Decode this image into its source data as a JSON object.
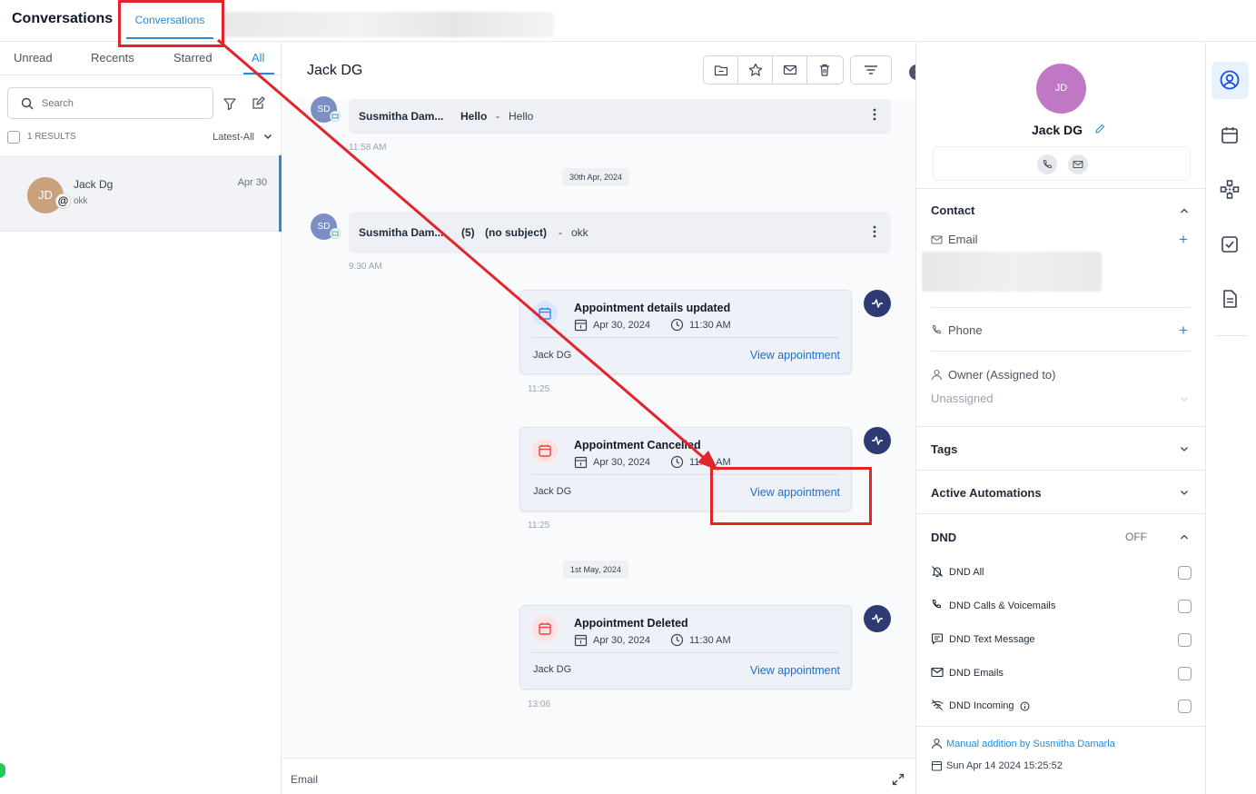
{
  "header": {
    "app_title": "Conversations",
    "active_tab": "Conversations"
  },
  "left_panel": {
    "tabs": [
      "Unread",
      "Recents",
      "Starred",
      "All"
    ],
    "search_placeholder": "Search",
    "results_label": "1 RESULTS",
    "sort_label": "Latest-All",
    "conversation": {
      "initials": "JD",
      "name": "Jack Dg",
      "preview": "okk",
      "date": "Apr 30",
      "badge": "@"
    }
  },
  "thread": {
    "title": "Jack DG",
    "messages": [
      {
        "initials": "SD",
        "sender": "Susmitha Dam...",
        "subject": "Hello",
        "separator": "-",
        "body": "Hello",
        "time": "11:58 AM"
      },
      {
        "initials": "SD",
        "sender": "Susmitha Dam...",
        "count": "(5)",
        "subject": "(no subject)",
        "separator": "-",
        "body": "okk",
        "time": "9:30 AM"
      }
    ],
    "date_dividers": [
      "30th Apr, 2024",
      "1st May, 2024"
    ],
    "appointments": [
      {
        "title": "Appointment details updated",
        "date": "Apr 30, 2024",
        "time": "11:30 AM",
        "owner": "Jack DG",
        "link": "View appointment",
        "timestamp": "11:25",
        "accent": "#3b82f6"
      },
      {
        "title": "Appointment Cancelled",
        "date": "Apr 30, 2024",
        "time": "11:30 AM",
        "owner": "Jack DG",
        "link": "View appointment",
        "timestamp": "11:25",
        "accent": "#ef4444"
      },
      {
        "title": "Appointment Deleted",
        "date": "Apr 30, 2024",
        "time": "11:30 AM",
        "owner": "Jack DG",
        "link": "View appointment",
        "timestamp": "13:06",
        "accent": "#ef4444"
      }
    ],
    "composer_label": "Email"
  },
  "contact": {
    "initials": "JD",
    "name": "Jack DG",
    "sections": {
      "contact": "Contact",
      "email_label": "Email",
      "phone_label": "Phone",
      "owner_label": "Owner (Assigned to)",
      "owner_value": "Unassigned",
      "tags": "Tags",
      "automations": "Active Automations",
      "dnd": "DND",
      "dnd_status": "OFF"
    },
    "dnd_options": [
      "DND All",
      "DND Calls & Voicemails",
      "DND Text Message",
      "DND Emails",
      "DND Incoming"
    ],
    "source": "Manual addition by Susmitha Damarla",
    "created": "Sun Apr 14 2024 15:25:52"
  },
  "colors": {
    "accent": "#2b8ad6",
    "link": "#1d6fd1",
    "annotation": "#e3242b",
    "activity": "#2e3a73"
  }
}
